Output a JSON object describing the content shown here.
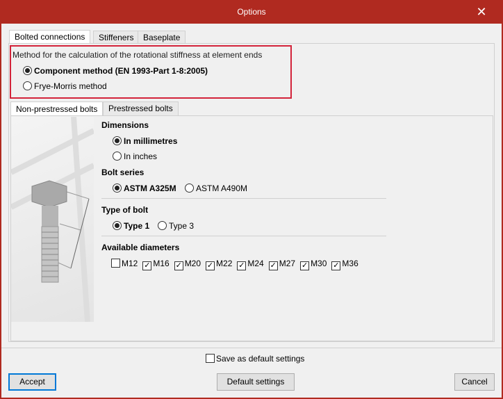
{
  "window": {
    "title": "Options",
    "close_icon": "close-icon"
  },
  "tabs": [
    "Bolted connections",
    "Stiffeners",
    "Baseplate"
  ],
  "method": {
    "label": "Method for the calculation of the rotational stiffness at element ends",
    "options": [
      "Component method (EN 1993-Part 1-8:2005)",
      "Frye-Morris method"
    ],
    "selected": 0
  },
  "subtabs": [
    "Non-prestressed bolts",
    "Prestressed bolts"
  ],
  "dimensions": {
    "label": "Dimensions",
    "options": [
      "In millimetres",
      "In inches"
    ]
  },
  "bolt_series": {
    "label": "Bolt series",
    "options": [
      "ASTM A325M",
      "ASTM A490M"
    ]
  },
  "bolt_type": {
    "label": "Type of bolt",
    "options": [
      "Type 1",
      "Type 3"
    ]
  },
  "diameters": {
    "label": "Available diameters",
    "items": [
      {
        "label": "M12",
        "checked": false
      },
      {
        "label": "M16",
        "checked": true
      },
      {
        "label": "M20",
        "checked": true
      },
      {
        "label": "M22",
        "checked": true
      },
      {
        "label": "M24",
        "checked": true
      },
      {
        "label": "M27",
        "checked": true
      },
      {
        "label": "M30",
        "checked": true
      },
      {
        "label": "M36",
        "checked": true
      }
    ]
  },
  "footer": {
    "save_default": "Save as default settings",
    "accept": "Accept",
    "default_settings": "Default settings",
    "cancel": "Cancel"
  },
  "colors": {
    "titlebar": "#b02a20",
    "highlight": "#d3233a",
    "focus": "#0078d7"
  }
}
